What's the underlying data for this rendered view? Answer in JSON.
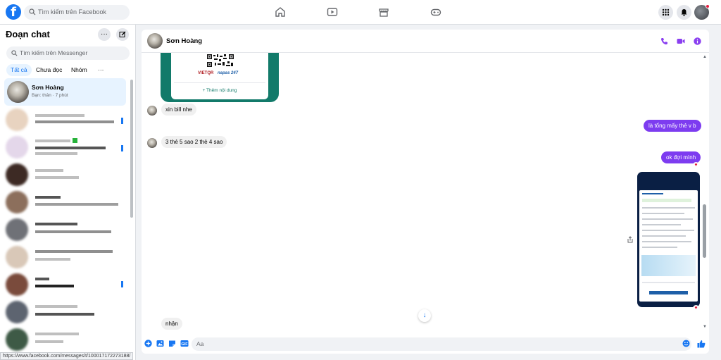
{
  "topbar": {
    "logo": "f",
    "search_placeholder": "Tìm kiếm trên Facebook",
    "nav_icons": [
      "home-icon",
      "watch-icon",
      "marketplace-icon",
      "gaming-icon"
    ],
    "right_icons": [
      "menu-grid-icon",
      "notifications-icon",
      "account-avatar"
    ]
  },
  "sidebar": {
    "title": "Đoạn chat",
    "more_label": "···",
    "search_placeholder": "Tìm kiếm trên Messenger",
    "tabs": [
      {
        "label": "Tất cả",
        "active": true
      },
      {
        "label": "Chưa đọc",
        "active": false
      },
      {
        "label": "Nhóm",
        "active": false
      },
      {
        "label": "···",
        "active": false
      }
    ],
    "active_conversation": {
      "name": "Sơn Hoàng",
      "subtitle": "Bạn: thân · 7 phút"
    }
  },
  "status_url": "https://www.facebook.com/messages/t/100017172273188/",
  "chat": {
    "contact_name": "Sơn Hoàng",
    "qr_card": {
      "brand_left": "VIETQR",
      "brand_right": "napas 247",
      "add_content": "+ Thêm nội dung"
    },
    "messages": {
      "in_1": "xin bill nhe",
      "out_1": "là tổng mấy thẻ v b",
      "in_2": "3 thẻ 5 sao 2 thẻ 4 sao",
      "out_2": "ok đợi mình",
      "in_3": "nhận"
    },
    "reaction": "♥",
    "scroll_down_icon": "↓",
    "composer_placeholder": "Aa",
    "accent_color": "#7d3cf0"
  }
}
